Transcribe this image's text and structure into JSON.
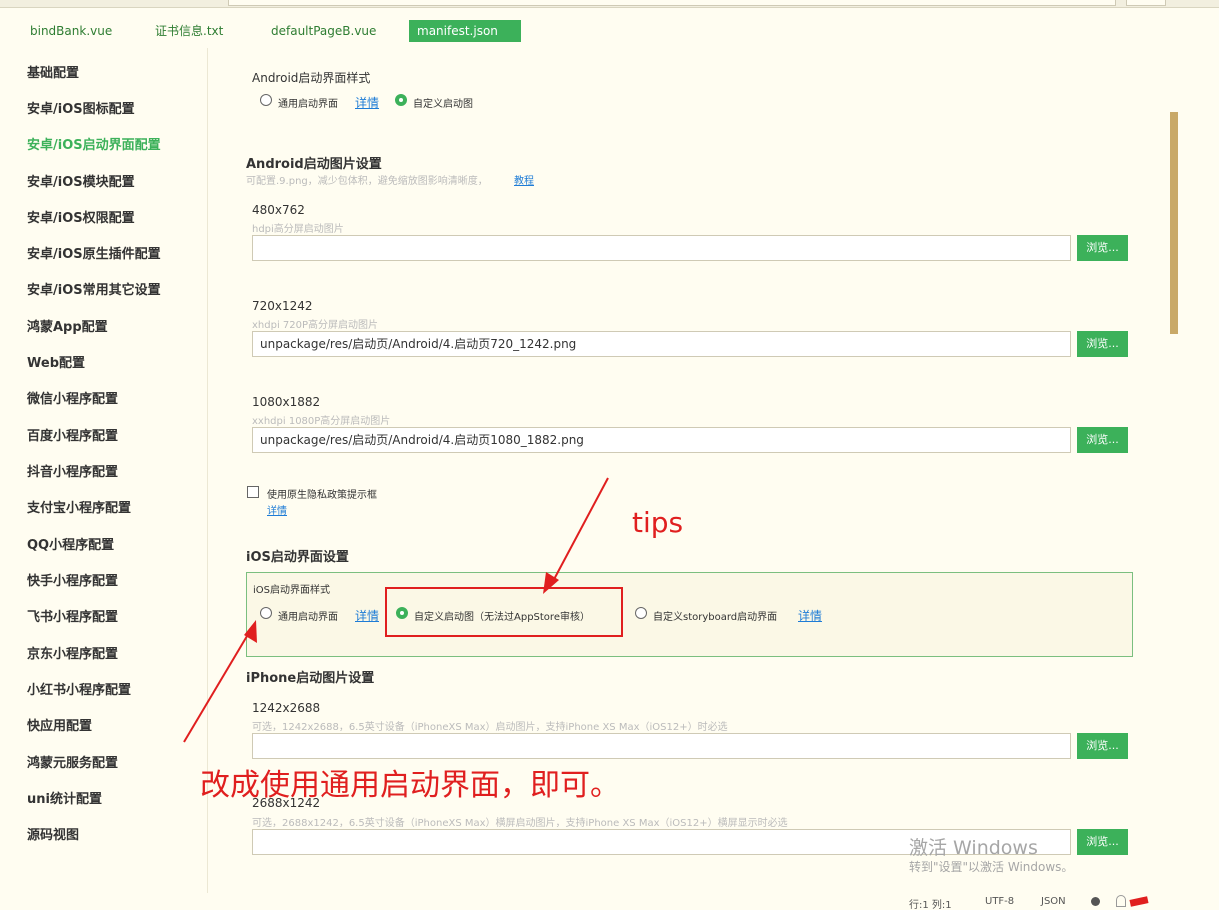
{
  "tabs": [
    "bindBank.vue",
    "证书信息.txt",
    "defaultPageB.vue",
    "manifest.json"
  ],
  "sidebar": {
    "items": [
      "基础配置",
      "安卓/iOS图标配置",
      "安卓/iOS启动界面配置",
      "安卓/iOS模块配置",
      "安卓/iOS权限配置",
      "安卓/iOS原生插件配置",
      "安卓/iOS常用其它设置",
      "鸿蒙App配置",
      "Web配置",
      "微信小程序配置",
      "百度小程序配置",
      "抖音小程序配置",
      "支付宝小程序配置",
      "QQ小程序配置",
      "快手小程序配置",
      "飞书小程序配置",
      "京东小程序配置",
      "小红书小程序配置",
      "快应用配置",
      "鸿蒙元服务配置",
      "uni统计配置",
      "源码视图"
    ],
    "active_index": 2
  },
  "android_style": {
    "title": "Android启动界面样式",
    "option_generic": "通用启动界面",
    "details": "详情",
    "option_custom": "自定义启动图",
    "selected": "custom"
  },
  "android_images": {
    "title": "Android启动图片设置",
    "hint": "可配置.9.png，减少包体积，避免缩放图影响清晰度，",
    "tutorial": "教程",
    "browse": "浏览...",
    "sizes": [
      {
        "size": "480x762",
        "desc": "hdpi高分屏启动图片",
        "value": ""
      },
      {
        "size": "720x1242",
        "desc": "xhdpi 720P高分屏启动图片",
        "value": "unpackage/res/启动页/Android/4.启动页720_1242.png"
      },
      {
        "size": "1080x1882",
        "desc": "xxhdpi 1080P高分屏启动图片",
        "value": "unpackage/res/启动页/Android/4.启动页1080_1882.png"
      }
    ]
  },
  "privacy": {
    "label": "使用原生隐私政策提示框",
    "details": "详情",
    "checked": false
  },
  "ios": {
    "section_title": "iOS启动界面设置",
    "style_title": "iOS启动界面样式",
    "option_generic": "通用启动界面",
    "details": "详情",
    "option_custom": "自定义启动图（无法过AppStore审核）",
    "option_storyboard": "自定义storyboard启动界面",
    "details2": "详情",
    "selected": "custom"
  },
  "iphone": {
    "title": "iPhone启动图片设置",
    "browse": "浏览...",
    "sizes": [
      {
        "size": "1242x2688",
        "desc": "可选，1242x2688，6.5英寸设备（iPhoneXS Max）启动图片，支持iPhone XS Max（iOS12+）时必选",
        "value": ""
      },
      {
        "size": "2688x1242",
        "desc": "可选，2688x1242，6.5英寸设备（iPhoneXS Max）横屏启动图片，支持iPhone XS Max（iOS12+）横屏显示时必选",
        "value": ""
      }
    ]
  },
  "annotations": {
    "tips": "tips",
    "instruction": "改成使用通用启动界面，即可。"
  },
  "watermark": {
    "line1": "激活 Windows",
    "line2": "转到\"设置\"以激活 Windows。"
  },
  "status": {
    "position": "行:1 列:1",
    "encoding": "UTF-8",
    "language": "JSON"
  },
  "colors": {
    "accent": "#3cb15a",
    "annotation": "#e01f1f",
    "background": "#fffdf1"
  }
}
